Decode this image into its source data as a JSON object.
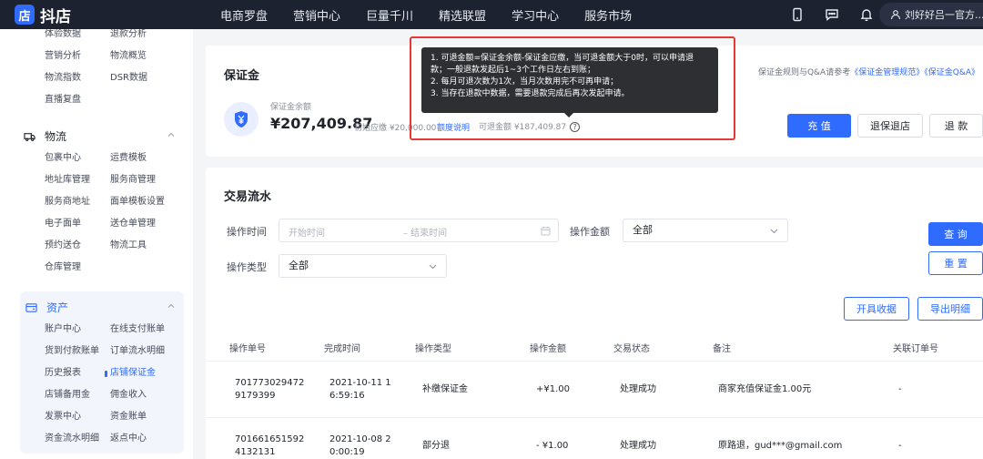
{
  "app": {
    "logo_text": "抖店",
    "logo_mark": "店"
  },
  "topnav": [
    "电商罗盘",
    "营销中心",
    "巨量千川",
    "精选联盟",
    "学习中心",
    "服务市场"
  ],
  "user": {
    "name": "刘好好吕一官方..."
  },
  "sidebar": {
    "top_links": [
      "体验数据",
      "退款分析",
      "营销分析",
      "物流概览",
      "物流指数",
      "DSR数据",
      "直播复盘"
    ],
    "logistics": {
      "title": "物流",
      "links": [
        "包裹中心",
        "运费模板",
        "地址库管理",
        "服务商管理",
        "服务商地址",
        "面单模板设置",
        "电子面单",
        "送仓单管理",
        "预约送仓",
        "物流工具",
        "仓库管理"
      ]
    },
    "assets": {
      "title": "资产",
      "links": [
        "账户中心",
        "在线支付账单",
        "货到付款账单",
        "订单流水明细",
        "历史报表",
        "店铺保证金",
        "店铺备用金",
        "佣金收入",
        "发票中心",
        "资金账单",
        "资金流水明细",
        "返点中心"
      ],
      "active": "店铺保证金"
    }
  },
  "deposit": {
    "title": "保证金",
    "balance_label": "保证金余额",
    "balance": "¥207,409.87",
    "initial_due": "初始应缴 ¥20,000.00",
    "quota_link": "额度说明",
    "refundable": "可退金额 ¥187,409.87",
    "help_mark": "?",
    "rule_prefix": "保证金规则与Q&A请参考",
    "rule_link1": "《保证金管理规范》",
    "rule_link2": "《保证金Q&A》",
    "btn_recharge": "充 值",
    "btn_exit": "退保退店",
    "btn_refund": "退 款"
  },
  "tooltip": {
    "lines": [
      "1. 可退金额=保证金余额-保证金应缴，当可退金额大于0时，可以申请退",
      "款；一般退款发起后1~3个工作日左右到账；",
      "2. 每月可退次数为1次，当月次数用完不可再申请；",
      "3. 当存在退款中数据，需要退款完成后再次发起申请。"
    ]
  },
  "transactions": {
    "title": "交易流水",
    "filters": {
      "time_label": "操作时间",
      "start_placeholder": "开始时间",
      "end_placeholder": "– 结束时间",
      "amount_label": "操作金额",
      "amount_value": "全部",
      "type_label": "操作类型",
      "type_value": "全部"
    },
    "btn_query": "查 询",
    "btn_reset": "重 置",
    "btn_receipt": "开具收据",
    "btn_export": "导出明细",
    "columns": [
      "操作单号",
      "完成时间",
      "操作类型",
      "操作金额",
      "交易状态",
      "备注",
      "关联订单号"
    ],
    "rows": [
      {
        "id_line1": "701773029472",
        "id_line2": "9179399",
        "time_line1": "2021-10-11 1",
        "time_line2": "6:59:16",
        "type": "补缴保证金",
        "amount": "+¥1.00",
        "status": "处理成功",
        "note": "商家充值保证金1.00元",
        "order": "-"
      },
      {
        "id_line1": "701661651592",
        "id_line2": "4132131",
        "time_line1": "2021-10-08 2",
        "time_line2": "0:00:19",
        "type": "部分退",
        "amount": "- ¥1.00",
        "status": "处理成功",
        "note": "原路退，gud***@gmail.com",
        "order": "-"
      }
    ]
  },
  "colors": {
    "brand": "#2f6bff",
    "topbar": "#1d2230",
    "highlight": "#e53935"
  }
}
